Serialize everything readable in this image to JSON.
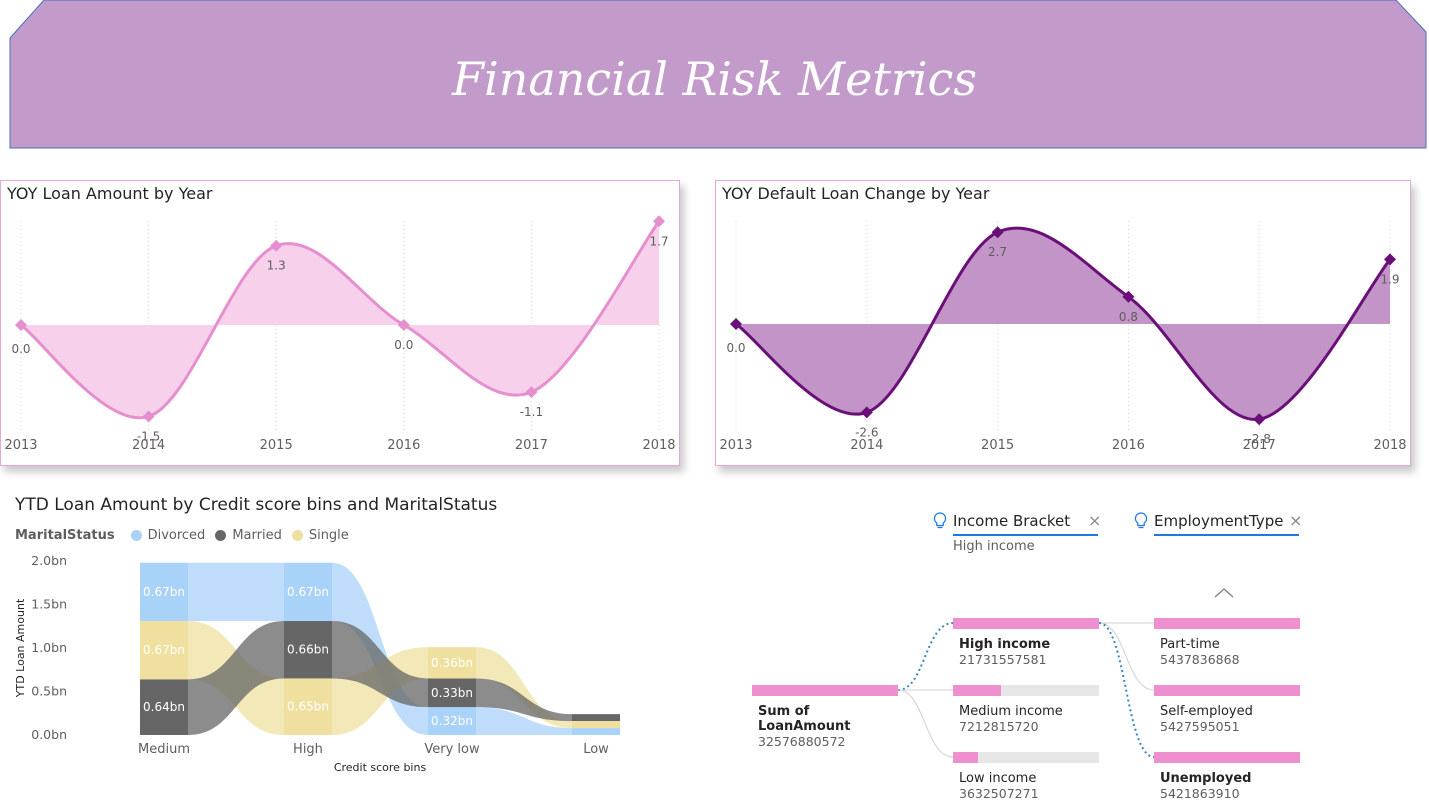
{
  "header": {
    "title": "Financial Risk Metrics",
    "color": "#c39bca"
  },
  "chart_data": [
    {
      "type": "line",
      "title": "YOY Loan Amount by Year",
      "x": [
        "2013",
        "2014",
        "2015",
        "2016",
        "2017",
        "2018"
      ],
      "values": [
        0.0,
        -1.5,
        1.3,
        0.0,
        -1.1,
        1.7
      ],
      "data_labels": [
        "0.0",
        "-1.5",
        "1.3",
        "0.0",
        "-1.1",
        "1.7"
      ],
      "ylim": [
        -2.0,
        2.0
      ],
      "line_color": "#e58fcf",
      "fill_color": "#f7d1ec"
    },
    {
      "type": "line",
      "title": "YOY Default Loan Change by Year",
      "x": [
        "2013",
        "2014",
        "2015",
        "2016",
        "2017",
        "2018"
      ],
      "values": [
        0.0,
        -2.6,
        2.7,
        0.8,
        -2.8,
        1.9
      ],
      "data_labels": [
        "0.0",
        "-2.6",
        "2.7",
        "0.8",
        "-2.8",
        "1.9"
      ],
      "ylim": [
        -3.0,
        3.0
      ],
      "line_color": "#6a0f78",
      "fill_color": "#c294c8"
    },
    {
      "type": "bar",
      "subtype": "ribbon",
      "title": "YTD Loan Amount by Credit score bins and MaritalStatus",
      "xlabel": "Credit score bins",
      "ylabel": "YTD Loan Amount",
      "categories": [
        "Medium",
        "High",
        "Very low",
        "Low"
      ],
      "y_ticks": [
        "0.0bn",
        "0.5bn",
        "1.0bn",
        "1.5bn",
        "2.0bn"
      ],
      "ylim": [
        0,
        2.0
      ],
      "legend_title": "MaritalStatus",
      "series": [
        {
          "name": "Divorced",
          "color": "#a9d2f8",
          "values": [
            0.67,
            0.67,
            0.32,
            0.08
          ],
          "labels": [
            "0.67bn",
            "0.67bn",
            "0.32bn",
            ""
          ]
        },
        {
          "name": "Married",
          "color": "#666666",
          "values": [
            0.64,
            0.66,
            0.33,
            0.08
          ],
          "labels": [
            "0.64bn",
            "0.66bn",
            "0.33bn",
            ""
          ]
        },
        {
          "name": "Single",
          "color": "#efe0a0",
          "values": [
            0.67,
            0.65,
            0.36,
            0.08
          ],
          "labels": [
            "0.67bn",
            "0.65bn",
            "0.36bn",
            ""
          ]
        }
      ]
    }
  ],
  "decomposition": {
    "slicers": [
      {
        "label": "Income Bracket",
        "selected": "High income"
      },
      {
        "label": "EmploymentType",
        "selected": ""
      }
    ],
    "root": {
      "label": "Sum of LoanAmount",
      "value": "32576880572",
      "fraction": 1.0
    },
    "level1": [
      {
        "label": "High income",
        "value": "21731557581",
        "fraction": 1.0,
        "selected": true
      },
      {
        "label": "Medium income",
        "value": "7212815720",
        "fraction": 0.33,
        "selected": false
      },
      {
        "label": "Low income",
        "value": "3632507271",
        "fraction": 0.17,
        "selected": false
      }
    ],
    "level2": [
      {
        "label": "Part-time",
        "value": "5437836868",
        "fraction": 1.0,
        "selected": false
      },
      {
        "label": "Self-employed",
        "value": "5427595051",
        "fraction": 1.0,
        "selected": false
      },
      {
        "label": "Unemployed",
        "value": "5421863910",
        "fraction": 1.0,
        "selected": true
      }
    ],
    "bar_color": "#ee90cf"
  }
}
